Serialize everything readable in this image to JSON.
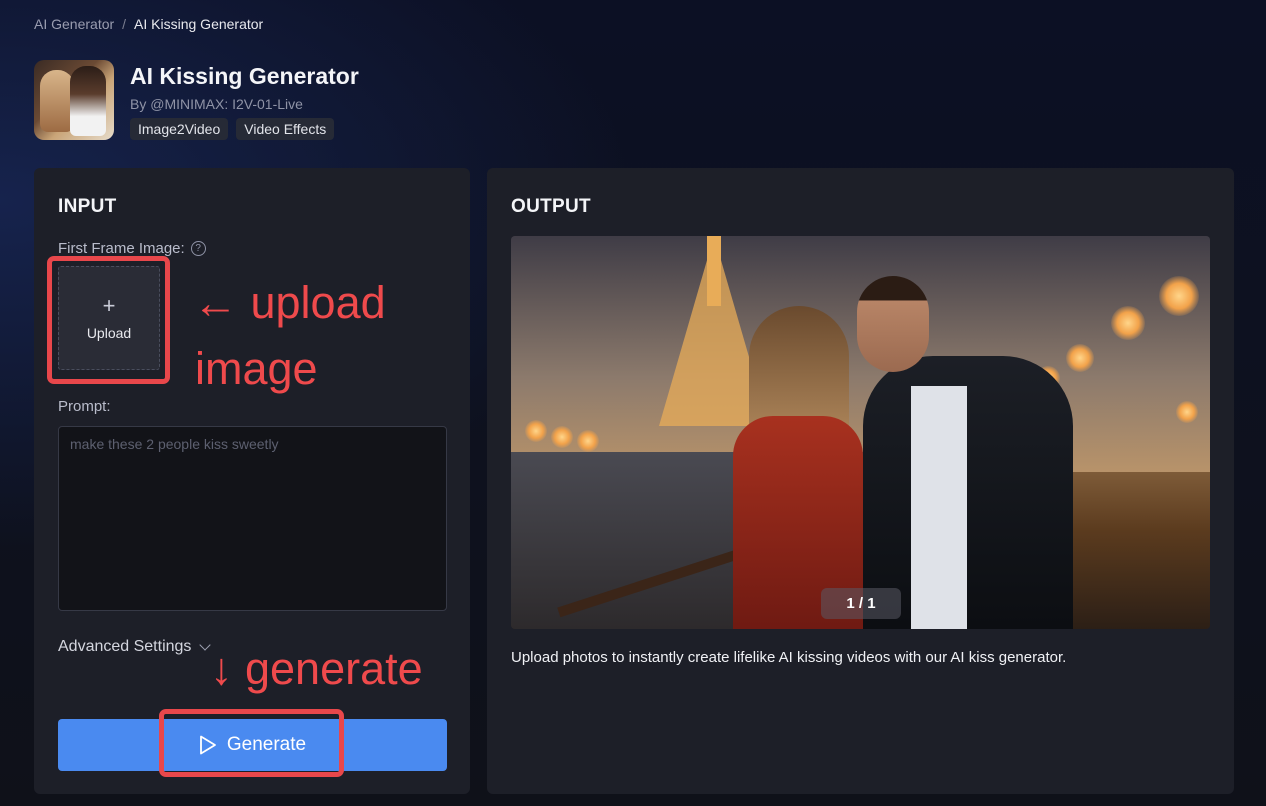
{
  "breadcrumb": {
    "parent": "AI Generator",
    "separator": "/",
    "current": "AI Kissing Generator"
  },
  "header": {
    "title": "AI Kissing Generator",
    "author": "By @MINIMAX: I2V-01-Live",
    "tags": [
      "Image2Video",
      "Video Effects"
    ]
  },
  "input": {
    "title": "INPUT",
    "first_frame_label": "First Frame Image:",
    "help_glyph": "?",
    "upload_plus": "+",
    "upload_label": "Upload",
    "prompt_label": "Prompt:",
    "prompt_placeholder": "make these 2 people kiss sweetly",
    "advanced_label": "Advanced Settings",
    "generate_label": "Generate"
  },
  "output": {
    "title": "OUTPUT",
    "counter": "1 / 1",
    "description": "Upload photos to instantly create lifelike AI kissing videos with our AI kiss generator."
  },
  "annotations": {
    "upload_line1": "← upload",
    "upload_line2": "image",
    "generate": "↓ generate",
    "color": "#e8474b"
  },
  "colors": {
    "accent": "#4a8af0",
    "panel": "#1d1f28"
  }
}
